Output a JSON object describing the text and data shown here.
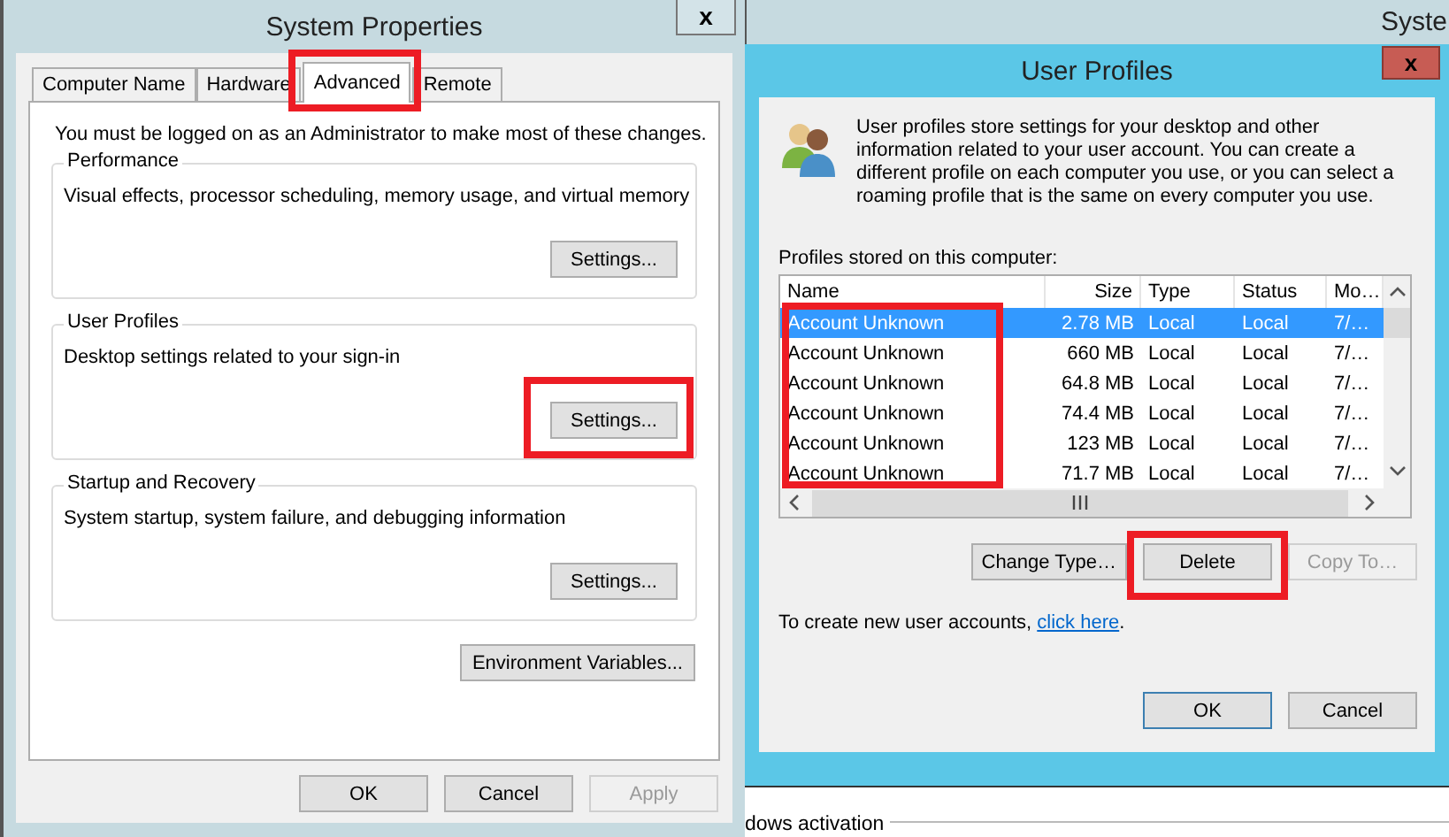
{
  "system_properties": {
    "title": "System Properties",
    "close": "x",
    "tabs": [
      {
        "label": "Computer Name",
        "selected": false,
        "annotated": false
      },
      {
        "label": "Hardware",
        "selected": false,
        "annotated": false
      },
      {
        "label": "Advanced",
        "selected": true,
        "annotated": true
      },
      {
        "label": "Remote",
        "selected": false,
        "annotated": false
      }
    ],
    "notice": "You must be logged on as an Administrator to make most of these changes.",
    "groups": [
      {
        "title": "Performance",
        "description": "Visual effects, processor scheduling, memory usage, and virtual memory",
        "button": {
          "label": "Settings...",
          "annotated": false
        }
      },
      {
        "title": "User Profiles",
        "description": "Desktop settings related to your sign-in",
        "button": {
          "label": "Settings...",
          "annotated": true
        }
      },
      {
        "title": "Startup and Recovery",
        "description": "System startup, system failure, and debugging information",
        "button": {
          "label": "Settings...",
          "annotated": false
        }
      }
    ],
    "env_button": "Environment Variables...",
    "buttons": [
      {
        "label": "OK",
        "disabled": false
      },
      {
        "label": "Cancel",
        "disabled": false
      },
      {
        "label": "Apply",
        "disabled": true
      }
    ]
  },
  "background_window": {
    "title": "Syste"
  },
  "user_profiles": {
    "title": "User Profiles",
    "close": "x",
    "description": "User profiles store settings for your desktop and other information related to your user account. You can create a different profile on each computer you use, or you can select a roaming profile that is the same on every computer you use.",
    "list_label": "Profiles stored on this computer:",
    "table": {
      "columns": [
        "Name",
        "Size",
        "Type",
        "Status",
        "Mo…"
      ],
      "name_column_annotated": true,
      "rows": [
        {
          "cells": [
            "Account Unknown",
            "2.78 MB",
            "Local",
            "Local",
            "7/…"
          ],
          "selected": true
        },
        {
          "cells": [
            "Account Unknown",
            "660 MB",
            "Local",
            "Local",
            "7/…"
          ],
          "selected": false
        },
        {
          "cells": [
            "Account Unknown",
            "64.8 MB",
            "Local",
            "Local",
            "7/…"
          ],
          "selected": false
        },
        {
          "cells": [
            "Account Unknown",
            "74.4 MB",
            "Local",
            "Local",
            "7/…"
          ],
          "selected": false
        },
        {
          "cells": [
            "Account Unknown",
            "123 MB",
            "Local",
            "Local",
            "7/…"
          ],
          "selected": false
        },
        {
          "cells": [
            "Account Unknown",
            "71.7 MB",
            "Local",
            "Local",
            "7/…"
          ],
          "selected": false
        }
      ]
    },
    "actions": [
      {
        "label": "Change Type…",
        "disabled": false,
        "annotated": false
      },
      {
        "label": "Delete",
        "disabled": false,
        "annotated": true
      },
      {
        "label": "Copy To…",
        "disabled": true,
        "annotated": false
      }
    ],
    "hint": {
      "text": "To create new user accounts, ",
      "link": "click here",
      "end": "."
    },
    "buttons": [
      {
        "label": "OK",
        "default": true
      },
      {
        "label": "Cancel",
        "default": false
      }
    ]
  },
  "background_text": "dows activation"
}
